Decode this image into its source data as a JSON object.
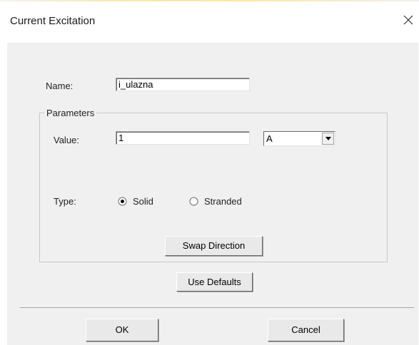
{
  "window": {
    "title": "Current Excitation",
    "close_symbol": "✕"
  },
  "form": {
    "name_label": "Name:",
    "name_value": "i_ulazna",
    "parameters_label": "Parameters",
    "value_label": "Value:",
    "value_value": "1",
    "unit_selected": "A",
    "type_label": "Type:",
    "type_options": [
      {
        "label": "Solid",
        "selected": true
      },
      {
        "label": "Stranded",
        "selected": false
      }
    ],
    "swap_direction_label": "Swap Direction",
    "use_defaults_label": "Use Defaults"
  },
  "footer": {
    "ok_label": "OK",
    "cancel_label": "Cancel"
  }
}
